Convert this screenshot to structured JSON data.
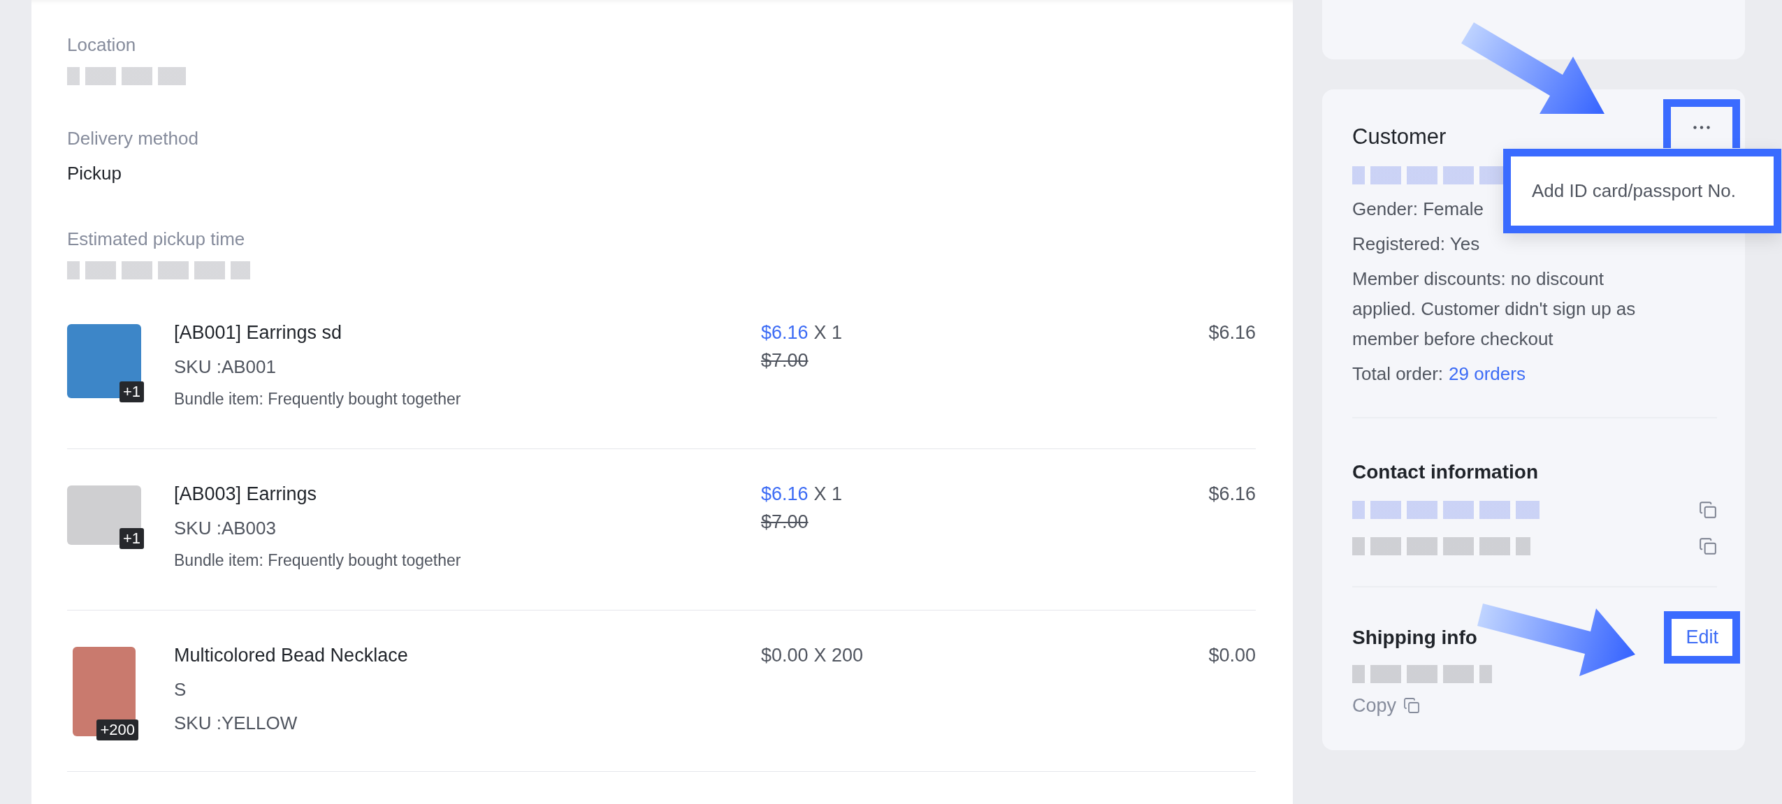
{
  "order_details": {
    "fields": [
      {
        "label": "Location",
        "value_redacted": true
      },
      {
        "label": "Delivery method",
        "value": "Pickup"
      },
      {
        "label": "Estimated pickup time",
        "value_redacted": true
      }
    ]
  },
  "items": [
    {
      "title": "[AB001] Earrings sd",
      "sku": "SKU :AB001",
      "note": "Bundle item: Frequently bought together",
      "badge": "+1",
      "price": "$6.16",
      "quantity": "X 1",
      "original_price": "$7.00",
      "discounted": true,
      "total": "$6.16"
    },
    {
      "title": "[AB003] Earrings",
      "sku": "SKU :AB003",
      "note": "Bundle item: Frequently bought together",
      "badge": "+1",
      "price": "$6.16",
      "quantity": "X 1",
      "original_price": "$7.00",
      "discounted": true,
      "total": "$6.16"
    },
    {
      "title": "Multicolored Bead Necklace",
      "variant": "S",
      "sku": "SKU :YELLOW",
      "badge": "+200",
      "price": "$0.00",
      "quantity": "X 200",
      "discounted": false,
      "total": "$0.00"
    }
  ],
  "customer": {
    "title": "Customer",
    "name_redacted": true,
    "menu_open": true,
    "menu_items": [
      "Add ID card/passport No."
    ],
    "lines": [
      "Gender: Female",
      "Registered: Yes",
      "Member discounts: no discount applied. Customer didn't sign up as member before checkout"
    ],
    "total_order_label": "Total order:",
    "total_order_link": "29 orders"
  },
  "contact": {
    "title": "Contact information",
    "entries": [
      {
        "kind": "link"
      },
      {
        "kind": "text"
      }
    ]
  },
  "shipping": {
    "title": "Shipping info",
    "edit": "Edit",
    "address_redacted": true,
    "copy": "Copy"
  }
}
